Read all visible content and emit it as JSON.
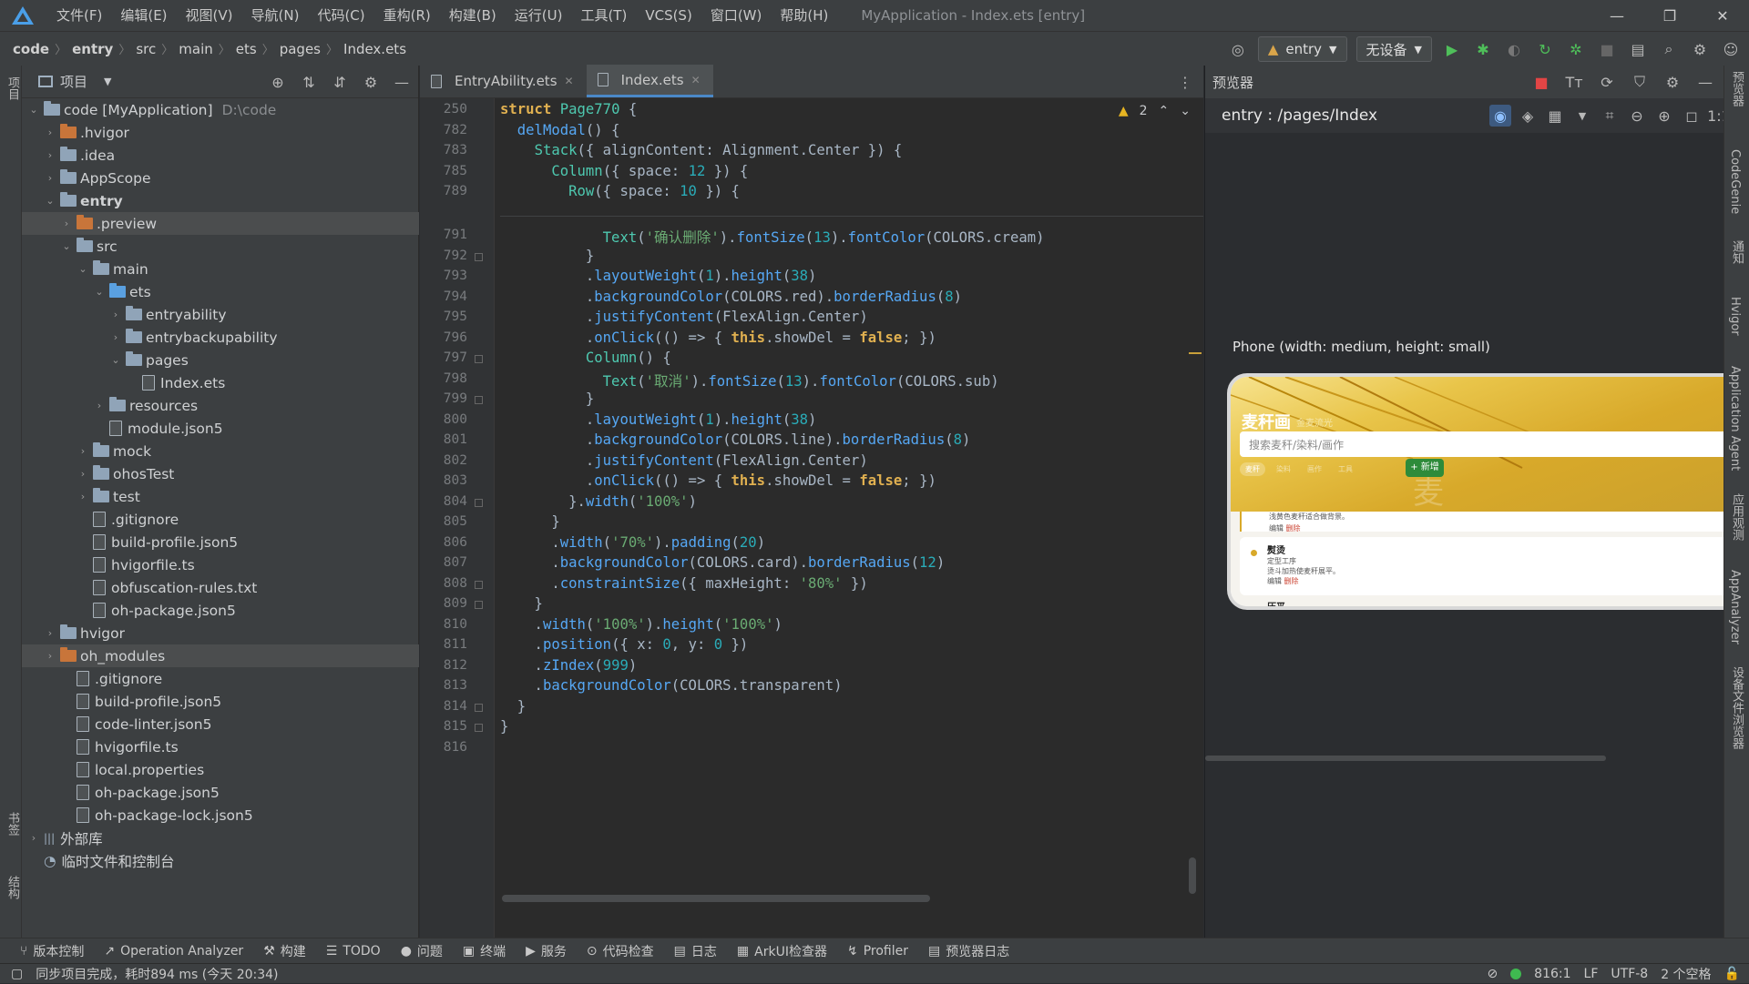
{
  "titlebar": {
    "menu": [
      "文件(F)",
      "编辑(E)",
      "视图(V)",
      "导航(N)",
      "代码(C)",
      "重构(R)",
      "构建(B)",
      "运行(U)",
      "工具(T)",
      "VCS(S)",
      "窗口(W)",
      "帮助(H)"
    ],
    "title": "MyApplication - Index.ets [entry]"
  },
  "breadcrumb": [
    "code",
    "entry",
    "src",
    "main",
    "ets",
    "pages",
    "Index.ets"
  ],
  "run": {
    "config": "entry",
    "device": "无设备"
  },
  "project": {
    "header": "项目",
    "items": [
      {
        "label": "code [MyApplication]",
        "extra": "D:\\code",
        "indent": 0,
        "arrow": "open",
        "kind": "proj"
      },
      {
        "label": ".hvigor",
        "indent": 1,
        "arrow": "closed",
        "kind": "folder-orange"
      },
      {
        "label": ".idea",
        "indent": 1,
        "arrow": "closed",
        "kind": "folder"
      },
      {
        "label": "AppScope",
        "indent": 1,
        "arrow": "closed",
        "kind": "folder"
      },
      {
        "label": "entry",
        "indent": 1,
        "arrow": "open",
        "kind": "folder",
        "bold": true
      },
      {
        "label": ".preview",
        "indent": 2,
        "arrow": "closed",
        "kind": "folder-orange",
        "selected": true
      },
      {
        "label": "src",
        "indent": 2,
        "arrow": "open",
        "kind": "folder"
      },
      {
        "label": "main",
        "indent": 3,
        "arrow": "open",
        "kind": "folder"
      },
      {
        "label": "ets",
        "indent": 4,
        "arrow": "open",
        "kind": "folder-blue"
      },
      {
        "label": "entryability",
        "indent": 5,
        "arrow": "closed",
        "kind": "folder"
      },
      {
        "label": "entrybackupability",
        "indent": 5,
        "arrow": "closed",
        "kind": "folder"
      },
      {
        "label": "pages",
        "indent": 5,
        "arrow": "open",
        "kind": "folder"
      },
      {
        "label": "Index.ets",
        "indent": 6,
        "arrow": "none",
        "kind": "file"
      },
      {
        "label": "resources",
        "indent": 4,
        "arrow": "closed",
        "kind": "folder"
      },
      {
        "label": "module.json5",
        "indent": 4,
        "arrow": "none",
        "kind": "file"
      },
      {
        "label": "mock",
        "indent": 3,
        "arrow": "closed",
        "kind": "folder"
      },
      {
        "label": "ohosTest",
        "indent": 3,
        "arrow": "closed",
        "kind": "folder"
      },
      {
        "label": "test",
        "indent": 3,
        "arrow": "closed",
        "kind": "folder"
      },
      {
        "label": ".gitignore",
        "indent": 3,
        "arrow": "none",
        "kind": "file"
      },
      {
        "label": "build-profile.json5",
        "indent": 3,
        "arrow": "none",
        "kind": "file"
      },
      {
        "label": "hvigorfile.ts",
        "indent": 3,
        "arrow": "none",
        "kind": "file"
      },
      {
        "label": "obfuscation-rules.txt",
        "indent": 3,
        "arrow": "none",
        "kind": "file"
      },
      {
        "label": "oh-package.json5",
        "indent": 3,
        "arrow": "none",
        "kind": "file"
      },
      {
        "label": "hvigor",
        "indent": 1,
        "arrow": "closed",
        "kind": "folder"
      },
      {
        "label": "oh_modules",
        "indent": 1,
        "arrow": "closed",
        "kind": "folder-orange",
        "selected": true
      },
      {
        "label": ".gitignore",
        "indent": 2,
        "arrow": "none",
        "kind": "file"
      },
      {
        "label": "build-profile.json5",
        "indent": 2,
        "arrow": "none",
        "kind": "file"
      },
      {
        "label": "code-linter.json5",
        "indent": 2,
        "arrow": "none",
        "kind": "file"
      },
      {
        "label": "hvigorfile.ts",
        "indent": 2,
        "arrow": "none",
        "kind": "file"
      },
      {
        "label": "local.properties",
        "indent": 2,
        "arrow": "none",
        "kind": "file"
      },
      {
        "label": "oh-package.json5",
        "indent": 2,
        "arrow": "none",
        "kind": "file"
      },
      {
        "label": "oh-package-lock.json5",
        "indent": 2,
        "arrow": "none",
        "kind": "file"
      },
      {
        "label": "外部库",
        "indent": 0,
        "arrow": "closed",
        "kind": "lib"
      },
      {
        "label": "临时文件和控制台",
        "indent": 0,
        "arrow": "none",
        "kind": "scratch"
      }
    ]
  },
  "editor": {
    "tabs": [
      {
        "label": "EntryAbility.ets",
        "active": false
      },
      {
        "label": "Index.ets",
        "active": true
      }
    ],
    "warnings": "2",
    "sticky": [
      {
        "n": "250",
        "html": "<span class='kw'>struct</span> <span class='fn2'>Page770</span> {"
      },
      {
        "n": "782",
        "html": "  <span class='fn'>delModal</span>() {"
      },
      {
        "n": "783",
        "html": "    <span class='fn2'>Stack</span>({ alignContent: Alignment.Center }) {"
      },
      {
        "n": "785",
        "html": "      <span class='fn2'>Column</span>({ space: <span class='num'>12</span> }) {"
      },
      {
        "n": "789",
        "html": "        <span class='fn2'>Row</span>({ space: <span class='num'>10</span> }) {"
      }
    ],
    "lines": [
      {
        "n": "791",
        "html": "            <span class='fn2'>Text</span>(<span class='str'>'确认删除'</span>).<span class='fn'>fontSize</span>(<span class='num'>13</span>).<span class='fn'>fontColor</span>(COLORS.cream)"
      },
      {
        "n": "792",
        "html": "          }"
      },
      {
        "n": "793",
        "html": "          .<span class='fn'>layoutWeight</span>(<span class='num'>1</span>).<span class='fn'>height</span>(<span class='num'>38</span>)"
      },
      {
        "n": "794",
        "html": "          .<span class='fn'>backgroundColor</span>(COLORS.red).<span class='fn'>borderRadius</span>(<span class='num'>8</span>)"
      },
      {
        "n": "795",
        "html": "          .<span class='fn'>justifyContent</span>(FlexAlign.Center)"
      },
      {
        "n": "796",
        "html": "          .<span class='fn'>onClick</span>(() => { <span class='kw'>this</span>.showDel = <span class='kw'>false</span>; })"
      },
      {
        "n": "797",
        "html": "          <span class='fn2'>Column</span>() {"
      },
      {
        "n": "798",
        "html": "            <span class='fn2'>Text</span>(<span class='str'>'取消'</span>).<span class='fn'>fontSize</span>(<span class='num'>13</span>).<span class='fn'>fontColor</span>(COLORS.sub)"
      },
      {
        "n": "799",
        "html": "          }"
      },
      {
        "n": "800",
        "html": "          .<span class='fn'>layoutWeight</span>(<span class='num'>1</span>).<span class='fn'>height</span>(<span class='num'>38</span>)"
      },
      {
        "n": "801",
        "html": "          .<span class='fn'>backgroundColor</span>(COLORS.line).<span class='fn'>borderRadius</span>(<span class='num'>8</span>)"
      },
      {
        "n": "802",
        "html": "          .<span class='fn'>justifyContent</span>(FlexAlign.Center)"
      },
      {
        "n": "803",
        "html": "          .<span class='fn'>onClick</span>(() => { <span class='kw'>this</span>.showDel = <span class='kw'>false</span>; })"
      },
      {
        "n": "804",
        "html": "        }.<span class='fn'>width</span>(<span class='str'>'100%'</span>)"
      },
      {
        "n": "805",
        "html": "      }"
      },
      {
        "n": "806",
        "html": "      .<span class='fn'>width</span>(<span class='str'>'70%'</span>).<span class='fn'>padding</span>(<span class='num'>20</span>)"
      },
      {
        "n": "807",
        "html": "      .<span class='fn'>backgroundColor</span>(COLORS.card).<span class='fn'>borderRadius</span>(<span class='num'>12</span>)"
      },
      {
        "n": "808",
        "html": "      .<span class='fn'>constraintSize</span>({ maxHeight: <span class='str'>'80%'</span> })"
      },
      {
        "n": "809",
        "html": "    }"
      },
      {
        "n": "810",
        "html": "    .<span class='fn'>width</span>(<span class='str'>'100%'</span>).<span class='fn'>height</span>(<span class='str'>'100%'</span>)"
      },
      {
        "n": "811",
        "html": "    .<span class='fn'>position</span>({ x: <span class='num'>0</span>, y: <span class='num'>0</span> })"
      },
      {
        "n": "812",
        "html": "    .<span class='fn'>zIndex</span>(<span class='num'>999</span>)"
      },
      {
        "n": "813",
        "html": "    .<span class='fn'>backgroundColor</span>(COLORS.transparent)"
      },
      {
        "n": "814",
        "html": "  }"
      },
      {
        "n": "815",
        "html": "}"
      },
      {
        "n": "816",
        "html": ""
      }
    ]
  },
  "previewer": {
    "header": "预览器",
    "path": "entry : /pages/Index",
    "device_label": "Phone (width: medium, height: small)",
    "app": {
      "title": "麦秆画",
      "subtitle": "金麦流光",
      "search_placeholder": "搜索麦秆/染料/画作",
      "add_button": "+ 新增",
      "chips": [
        "麦秆",
        "染料",
        "画作",
        "工具"
      ],
      "watermark": "麦",
      "item1_desc": "浅黄色麦秆适合做背景。",
      "item1_edit": "编辑",
      "item1_del": "删除",
      "item2_title": "熨烫",
      "item2_line1": "定型工序",
      "item2_line2": "烫斗加热使麦秆展平。",
      "item2_edit": "编辑",
      "item2_del": "删除",
      "item3_title": "压平"
    }
  },
  "sidestrip": {
    "left": [
      "项目",
      "书签",
      "结构"
    ],
    "right": [
      "预览器",
      "CodeGenie",
      "通知",
      "Hvigor",
      "Application Agent",
      "应用观测",
      "AppAnalyzer",
      "设备文件浏览器"
    ]
  },
  "bottomtools": [
    "版本控制",
    "Operation Analyzer",
    "构建",
    "TODO",
    "问题",
    "终端",
    "服务",
    "代码检查",
    "日志",
    "ArkUI检查器",
    "Profiler",
    "预览器日志"
  ],
  "status": {
    "message": "同步项目完成，耗时894 ms (今天 20:34)",
    "position": "816:1",
    "lf": "LF",
    "encoding": "UTF-8",
    "indent": "2 个空格"
  }
}
